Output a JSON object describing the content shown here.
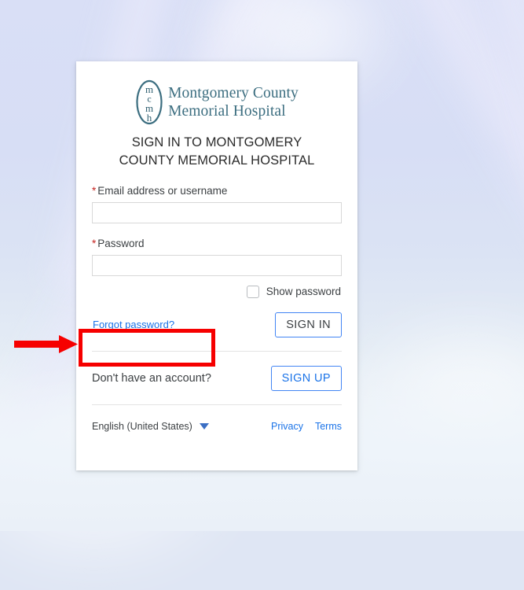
{
  "background": {
    "top_color": "#d9dff6",
    "bottom_color": "#eaf0f8"
  },
  "card": {
    "logo": {
      "mark_alt": "mcmh monogram in ellipse",
      "mark_letters": [
        "m",
        "c",
        "m",
        "h"
      ],
      "name_line1": "Montgomery County",
      "name_line2": "Memorial Hospital",
      "color": "#3c6e80"
    },
    "heading": "SIGN IN TO MONTGOMERY COUNTY MEMORIAL HOSPITAL",
    "fields": [
      {
        "name": "email",
        "required_marker": "*",
        "label": "Email address or username",
        "value": "",
        "placeholder": ""
      },
      {
        "name": "password",
        "required_marker": "*",
        "label": "Password",
        "value": "",
        "placeholder": ""
      }
    ],
    "show_password": {
      "label": "Show password",
      "checked": false
    },
    "forgot_password_link": "Forgot password?",
    "sign_in_button": "SIGN IN",
    "sign_up_prompt": "Don't have an account?",
    "sign_up_button": "SIGN UP",
    "footer": {
      "language": "English (United States)",
      "caret_icon": "chevron-down-icon",
      "privacy": "Privacy",
      "terms": "Terms"
    }
  },
  "annotations": {
    "highlight_color": "#f60000",
    "arrow_color": "#f60000",
    "target": "Forgot password?"
  },
  "colors": {
    "link_blue": "#1a73e8",
    "button_border": "#4285f4",
    "required_red": "#c5221f",
    "brand_teal": "#3c6e80"
  }
}
